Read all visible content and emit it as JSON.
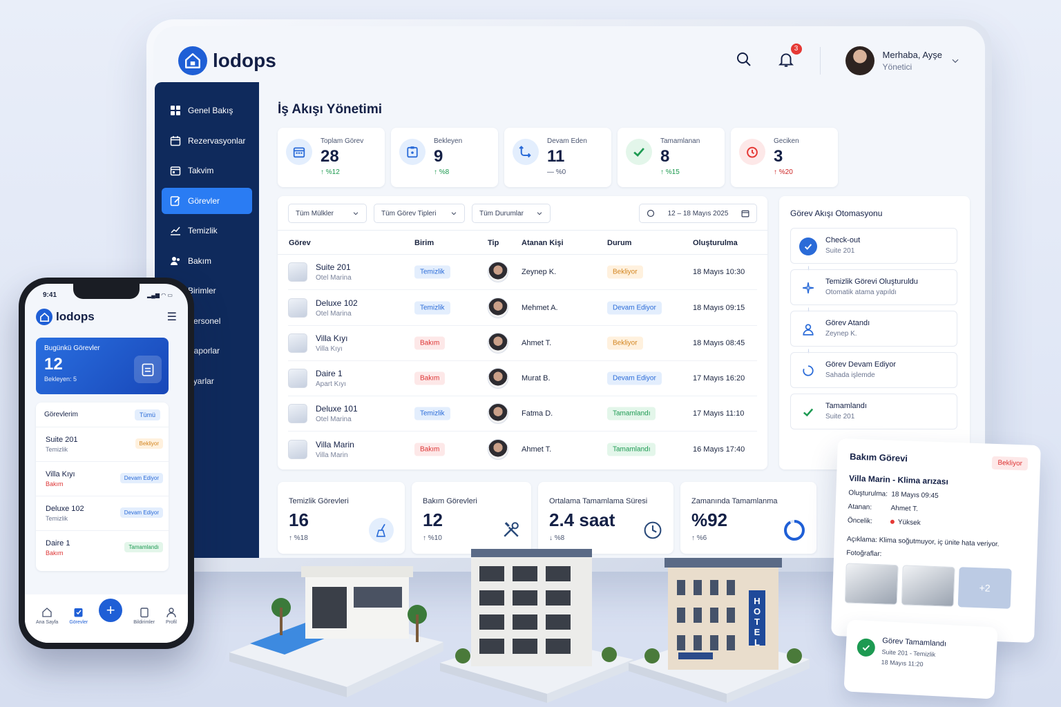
{
  "app": {
    "name": "lodops"
  },
  "header": {
    "notification_count": "3",
    "greeting": "Merhaba, Ayşe",
    "role": "Yönetici"
  },
  "sidebar": {
    "items": [
      {
        "label": "Genel Bakış",
        "icon": "grid-icon"
      },
      {
        "label": "Rezervasyonlar",
        "icon": "calendar-icon"
      },
      {
        "label": "Takvim",
        "icon": "calendar-icon"
      },
      {
        "label": "Görevler",
        "icon": "task-edit-icon",
        "active": true
      },
      {
        "label": "Temizlik",
        "icon": "chart-icon"
      },
      {
        "label": "Bakım",
        "icon": "users-icon"
      },
      {
        "label": "Birimler",
        "icon": "building-icon"
      },
      {
        "label": "Personel",
        "icon": "people-icon"
      },
      {
        "label": "Raporlar",
        "icon": "report-icon"
      },
      {
        "label": "Ayarlar",
        "icon": "gear-icon"
      }
    ]
  },
  "main": {
    "title": "İş Akışı Yönetimi",
    "kpis": [
      {
        "label": "Toplam Görev",
        "value": "28",
        "delta": "↑ %12",
        "color": "#2a6bd8"
      },
      {
        "label": "Bekleyen",
        "value": "9",
        "delta": "↑ %8",
        "color": "#2a6bd8"
      },
      {
        "label": "Devam Eden",
        "value": "11",
        "delta": "— %0",
        "color": "#2a6bd8"
      },
      {
        "label": "Tamamlanan",
        "value": "8",
        "delta": "↑ %15",
        "color": "#1d9a52"
      },
      {
        "label": "Geciken",
        "value": "3",
        "delta": "↑ %20",
        "color": "#e53935"
      }
    ],
    "filters": {
      "property": "Tüm Mülkler",
      "task_type": "Tüm Görev Tipleri",
      "status": "Tüm Durumlar",
      "date_range": "12 – 18 Mayıs 2025"
    },
    "table": {
      "columns": [
        "Görev",
        "Birim",
        "Tip",
        "Atanan Kişi",
        "Durum",
        "Oluşturulma"
      ],
      "rows": [
        {
          "name": "Suite 201",
          "location": "Otel Marina",
          "type": "Temizlik",
          "assignee": "Zeynep K.",
          "status": "Bekliyor",
          "created": "18 Mayıs 10:30"
        },
        {
          "name": "Deluxe 102",
          "location": "Otel Marina",
          "type": "Temizlik",
          "assignee": "Mehmet A.",
          "status": "Devam Ediyor",
          "created": "18 Mayıs 09:15"
        },
        {
          "name": "Villa Kıyı",
          "location": "Villa Kıyı",
          "type": "Bakım",
          "assignee": "Ahmet T.",
          "status": "Bekliyor",
          "created": "18 Mayıs 08:45"
        },
        {
          "name": "Daire 1",
          "location": "Apart Kıyı",
          "type": "Bakım",
          "assignee": "Murat B.",
          "status": "Devam Ediyor",
          "created": "17 Mayıs 16:20"
        },
        {
          "name": "Deluxe 101",
          "location": "Otel Marina",
          "type": "Temizlik",
          "assignee": "Fatma D.",
          "status": "Tamamlandı",
          "created": "17 Mayıs 11:10"
        },
        {
          "name": "Villa Marin",
          "location": "Villa Marin",
          "type": "Bakım",
          "assignee": "Ahmet T.",
          "status": "Tamamlandı",
          "created": "16 Mayıs 17:40"
        }
      ]
    },
    "automation": {
      "title": "Görev Akışı Otomasyonu",
      "steps": [
        {
          "title": "Check-out",
          "sub": "Suite 201"
        },
        {
          "title": "Temizlik Görevi Oluşturuldu",
          "sub": "Otomatik atama yapıldı"
        },
        {
          "title": "Görev Atandı",
          "sub": "Zeynep K."
        },
        {
          "title": "Görev Devam Ediyor",
          "sub": "Sahada işlemde"
        },
        {
          "title": "Tamamlandı",
          "sub": "Suite 201"
        }
      ]
    },
    "stats": [
      {
        "label": "Temizlik Görevleri",
        "value": "16",
        "delta": "↑ %18"
      },
      {
        "label": "Bakım Görevleri",
        "value": "12",
        "delta": "↑ %10"
      },
      {
        "label": "Ortalama Tamamlama Süresi",
        "value": "2.4 saat",
        "delta": "↓ %8"
      },
      {
        "label": "Zamanında Tamamlanma",
        "value": "%92",
        "delta": "↑ %6",
        "progress": 0.92
      }
    ]
  },
  "phone": {
    "time": "9:41",
    "app_name": "lodops",
    "today": {
      "title": "Bugünkü Görevler",
      "value": "12",
      "sub": "Bekleyen: 5"
    },
    "list": {
      "title": "Görevlerim",
      "all": "Tümü",
      "items": [
        {
          "name": "Suite 201",
          "type": "Temizlik",
          "status": "Bekliyor"
        },
        {
          "name": "Villa Kıyı",
          "type": "Bakım",
          "status": "Devam Ediyor"
        },
        {
          "name": "Deluxe 102",
          "type": "Temizlik",
          "status": "Devam Ediyor"
        },
        {
          "name": "Daire 1",
          "type": "Bakım",
          "status": "Tamamlandı"
        }
      ]
    },
    "tabs": [
      "Ana Sayfa",
      "Görevler",
      "Bildirimler",
      "Profil"
    ]
  },
  "buildings": {
    "hotel_sign": "HOTEL"
  },
  "maintenance_card": {
    "title": "Bakım Görevi",
    "status": "Bekliyor",
    "subject": "Villa Marin - Klima arızası",
    "created_label": "Oluşturulma:",
    "created": "18 Mayıs 09:45",
    "assignee_label": "Atanan:",
    "assignee": "Ahmet T.",
    "priority_label": "Öncelik:",
    "priority": "Yüksek",
    "description_label": "Açıklama:",
    "description": "Klima soğutmuyor, iç ünite hata veriyor.",
    "photos_label": "Fotoğraflar:",
    "more_photos": "+2"
  },
  "done_card": {
    "title": "Görev Tamamlandı",
    "sub": "Suite 201 - Temizlik",
    "time": "18 Mayıs 11:20"
  }
}
